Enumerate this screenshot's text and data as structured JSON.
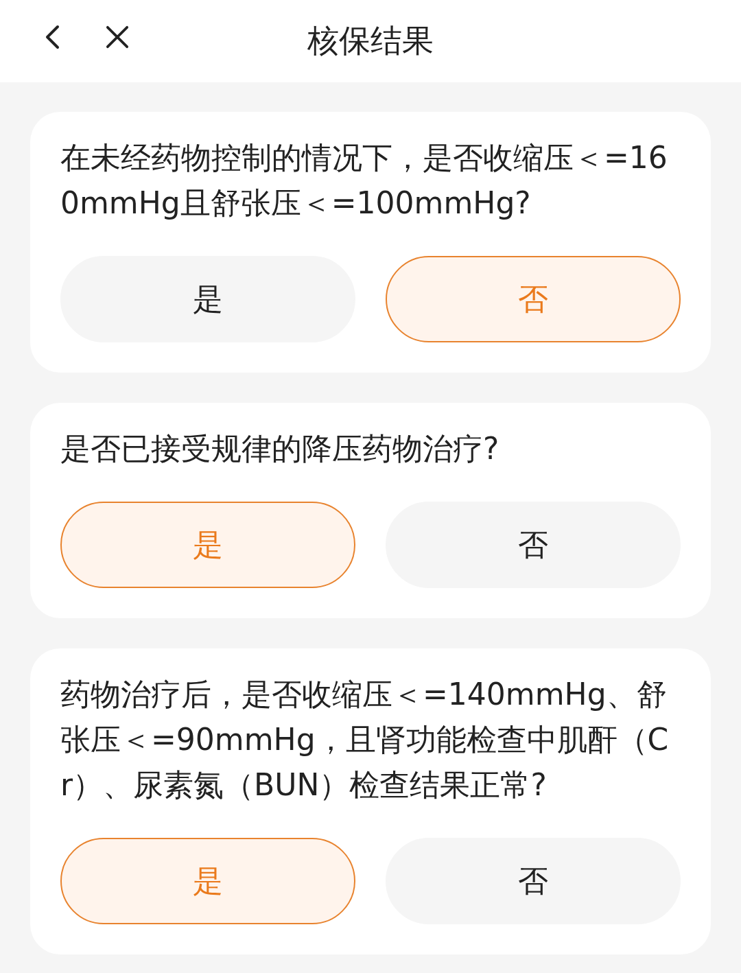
{
  "header": {
    "title": "核保结果"
  },
  "questions": [
    {
      "text": "在未经药物控制的情况下，是否收缩压＜=160mmHg且舒张压＜=100mmHg?",
      "options": [
        {
          "label": "是",
          "selected": false
        },
        {
          "label": "否",
          "selected": true
        }
      ]
    },
    {
      "text": "是否已接受规律的降压药物治疗?",
      "options": [
        {
          "label": "是",
          "selected": true
        },
        {
          "label": "否",
          "selected": false
        }
      ]
    },
    {
      "text": "药物治疗后，是否收缩压＜=140mmHg、舒张压＜=90mmHg，且肾功能检查中肌酐（Cr）、尿素氮（BUN）检查结果正常?",
      "options": [
        {
          "label": "是",
          "selected": true
        },
        {
          "label": "否",
          "selected": false
        }
      ]
    }
  ]
}
